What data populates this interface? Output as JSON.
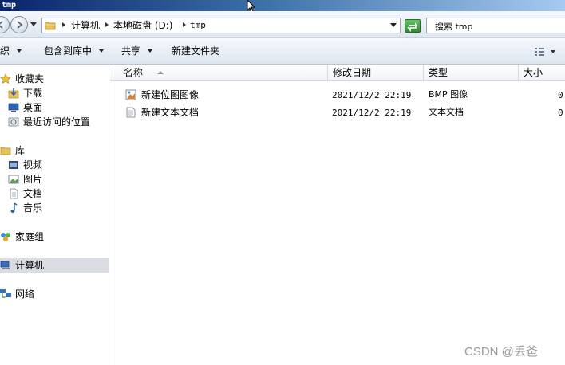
{
  "window": {
    "title": "tmp"
  },
  "address": {
    "crumbs": [
      "计算机",
      "本地磁盘 (D:)",
      "tmp"
    ]
  },
  "search": {
    "placeholder": "搜索 tmp"
  },
  "toolbar": {
    "organize": "组织",
    "include_in_library": "包含到库中",
    "share": "共享",
    "new_folder": "新建文件夹"
  },
  "sidebar": {
    "favorites": "收藏夹",
    "downloads": "下载",
    "desktop": "桌面",
    "recent_places": "最近访问的位置",
    "libraries": "库",
    "videos": "视频",
    "pictures": "图片",
    "documents": "文档",
    "music": "音乐",
    "homegroup": "家庭组",
    "computer": "计算机",
    "network": "网络"
  },
  "columns": {
    "name": "名称",
    "date_modified": "修改日期",
    "type": "类型",
    "size": "大小"
  },
  "files": [
    {
      "name": "新建位图图像",
      "date": "2021/12/2 22:19",
      "type": "BMP 图像",
      "size": "0"
    },
    {
      "name": "新建文本文档",
      "date": "2021/12/2 22:19",
      "type": "文本文档",
      "size": "0"
    }
  ],
  "watermark": "CSDN @丢爸",
  "colors": {
    "title_bar": "#0a246a",
    "selection": "#d9dde3",
    "refresh": "#2e8b2e"
  }
}
